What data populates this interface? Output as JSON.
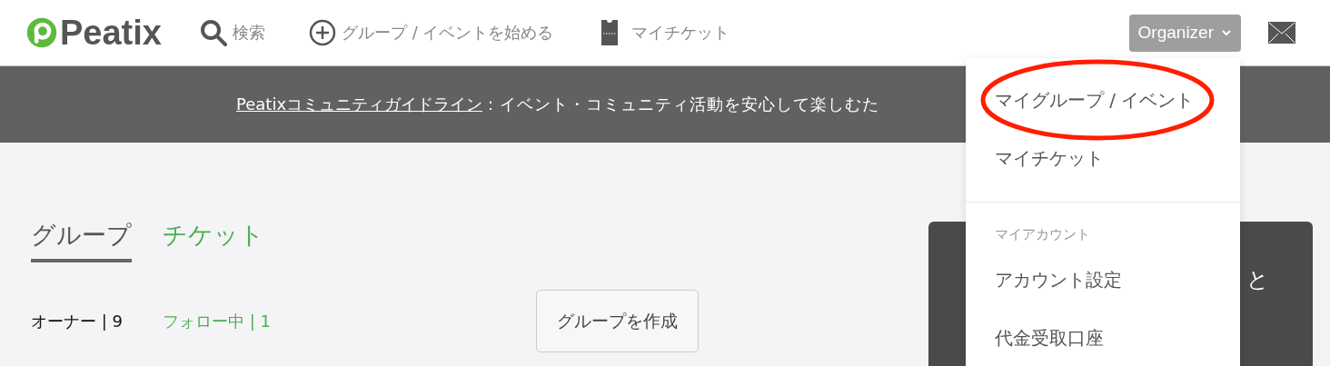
{
  "header": {
    "logo": "Peatix",
    "nav": [
      {
        "kind": "search",
        "label": "検索"
      },
      {
        "kind": "create",
        "label": "グループ / イベントを始める"
      },
      {
        "kind": "ticket",
        "label": "マイチケット"
      }
    ],
    "account_button": {
      "label": "Organizer"
    }
  },
  "banner": {
    "link": "Peatixコミュニティガイドライン",
    "text": "：イベント・コミュニティ活動を安心して楽しむた"
  },
  "tabs": [
    {
      "label": "グループ",
      "selected": true
    },
    {
      "label": "チケット",
      "selected": false
    }
  ],
  "counts": [
    {
      "label": "オーナー | 9",
      "selected": true
    },
    {
      "label": "フォロー中 | 1",
      "selected": false
    }
  ],
  "create_button": "グループを作成",
  "side_card": {
    "text": "と"
  },
  "menu": {
    "items": [
      {
        "kind": "item",
        "label": "マイグループ / イベント",
        "circled": true
      },
      {
        "kind": "item",
        "label": "マイチケット",
        "circled": false
      },
      {
        "kind": "divider"
      },
      {
        "kind": "header",
        "label": "マイアカウント"
      },
      {
        "kind": "item",
        "label": "アカウント設定",
        "circled": false
      },
      {
        "kind": "item",
        "label": "代金受取口座",
        "circled": false
      }
    ]
  }
}
